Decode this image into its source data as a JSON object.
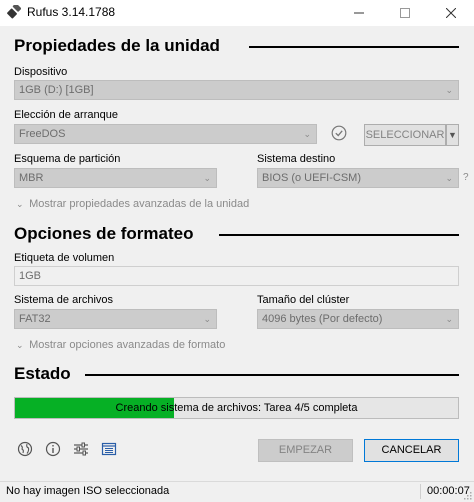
{
  "window": {
    "title": "Rufus 3.14.1788"
  },
  "drive_properties": {
    "heading": "Propiedades de la unidad",
    "device_label": "Dispositivo",
    "device_value": "1GB (D:) [1GB]",
    "boot_label": "Elección de arranque",
    "boot_value": "FreeDOS",
    "select_button": "SELECCIONAR",
    "partition_label": "Esquema de partición",
    "partition_value": "MBR",
    "target_label": "Sistema destino",
    "target_value": "BIOS (o UEFI-CSM)",
    "target_help": "?",
    "advanced_toggle": "Mostrar propiedades avanzadas de la unidad"
  },
  "format_options": {
    "heading": "Opciones de formateo",
    "volume_label": "Etiqueta de volumen",
    "volume_value": "1GB",
    "filesystem_label": "Sistema de archivos",
    "filesystem_value": "FAT32",
    "cluster_label": "Tamaño del clúster",
    "cluster_value": "4096 bytes (Por defecto)",
    "advanced_toggle": "Mostrar opciones avanzadas de formato"
  },
  "status": {
    "heading": "Estado",
    "progress_text": "Creando sistema de archivos: Tarea 4/5 completa",
    "progress_fraction": 0.36,
    "progress_color": "#06b025"
  },
  "toolbar": {
    "icons": [
      "globe-icon",
      "info-icon",
      "settings-sliders-icon",
      "log-icon"
    ]
  },
  "actions": {
    "start_label": "EMPEZAR",
    "cancel_label": "CANCELAR"
  },
  "statusbar": {
    "message": "No hay imagen ISO seleccionada",
    "timer": "00:00:07"
  },
  "colors": {
    "accent": "#0078d7",
    "progress": "#06b025",
    "disabled_field": "#cccccc"
  }
}
